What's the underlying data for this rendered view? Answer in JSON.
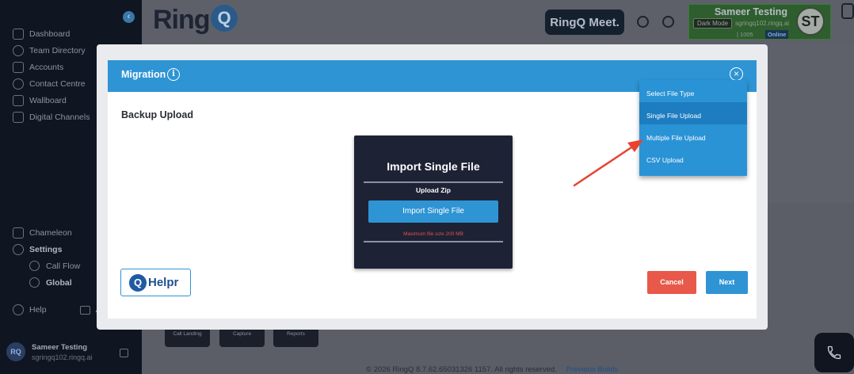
{
  "sidebar": {
    "nav": [
      {
        "label": "Dashboard"
      },
      {
        "label": "Team Directory"
      },
      {
        "label": "Accounts"
      },
      {
        "label": "Contact Centre"
      },
      {
        "label": "Wallboard"
      },
      {
        "label": "Digital Channels"
      }
    ],
    "bottom_nav": [
      {
        "label": "Chameleon"
      },
      {
        "label": "Settings"
      }
    ],
    "sub_nav": [
      {
        "label": "Call Flow"
      },
      {
        "label": "Global"
      }
    ],
    "help_label": "Help",
    "help_second_label": "A",
    "user": {
      "initials": "RQ",
      "name": "Sameer Testing",
      "domain": "sgringq102.ringq.ai"
    }
  },
  "header": {
    "logo_text": "Ring",
    "logo_q": "Q",
    "meet_label": "RingQ Meet.",
    "user_name": "Sameer Testing",
    "dark_mode_label": "Dark Mode",
    "user_email": "sgringq102.ringq.ai",
    "extension": "| 1005",
    "status": "Online",
    "avatar_initials": "ST"
  },
  "background": {
    "thumbs": [
      "Call Landing",
      "Capture",
      "Reports"
    ],
    "footer": "© 2026 RingQ 8.7.62.65031326 1157. All rights reserved.",
    "previous_builds": "Previous Builds"
  },
  "modal": {
    "title": "Migration",
    "section_title": "Backup Upload",
    "card": {
      "title": "Import Single File",
      "upload_label": "Upload Zip",
      "button_label": "Import Single File",
      "max_size": "Maximum file size 200 MB"
    },
    "helpr_label": "Helpr",
    "cancel_label": "Cancel",
    "next_label": "Next",
    "file_type_dropdown": {
      "options": [
        "Select File Type",
        "Single File Upload",
        "Multiple File Upload",
        "CSV Upload"
      ],
      "selected": "Single File Upload"
    }
  },
  "colors": {
    "accent": "#2e94d4",
    "cancel": "#e8594a",
    "arrow": "#e8432f"
  }
}
